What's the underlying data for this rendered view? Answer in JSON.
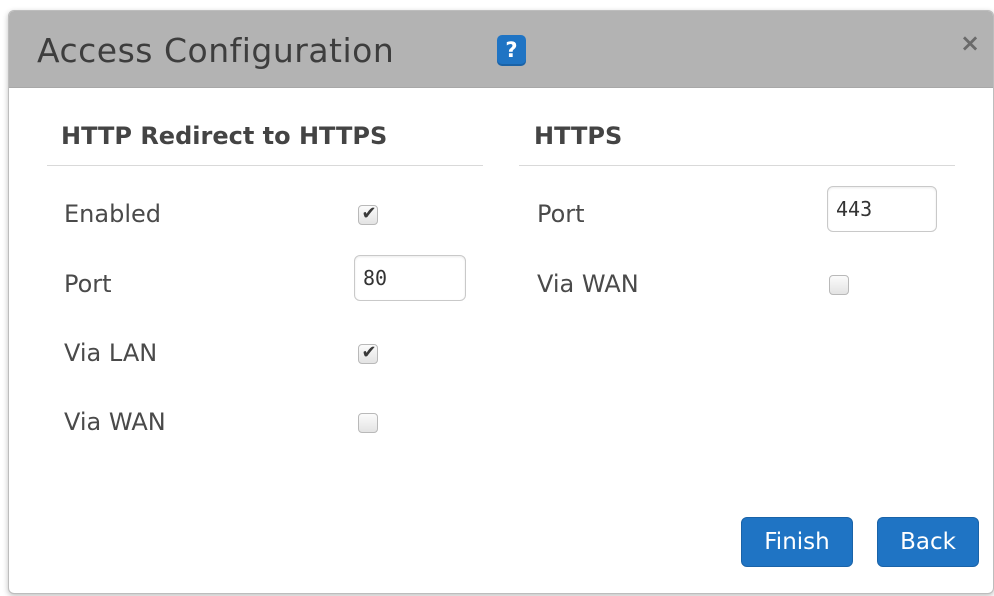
{
  "dialog": {
    "title": "Access Configuration",
    "help_icon": "?",
    "close_icon": "×"
  },
  "left_section": {
    "title": "HTTP Redirect to HTTPS",
    "enabled_label": "Enabled",
    "enabled_checked": true,
    "port_label": "Port",
    "port_value": "80",
    "via_lan_label": "Via LAN",
    "via_lan_checked": true,
    "via_wan_label": "Via WAN",
    "via_wan_checked": false
  },
  "right_section": {
    "title": "HTTPS",
    "port_label": "Port",
    "port_value": "443",
    "via_wan_label": "Via WAN",
    "via_wan_checked": false
  },
  "buttons": {
    "finish_label": "Finish",
    "back_label": "Back"
  },
  "icons": {
    "check": "✔",
    "help": "help-icon",
    "close": "close-icon"
  },
  "colors": {
    "accent": "#1f74c4",
    "titlebar": "#b3b3b3"
  }
}
